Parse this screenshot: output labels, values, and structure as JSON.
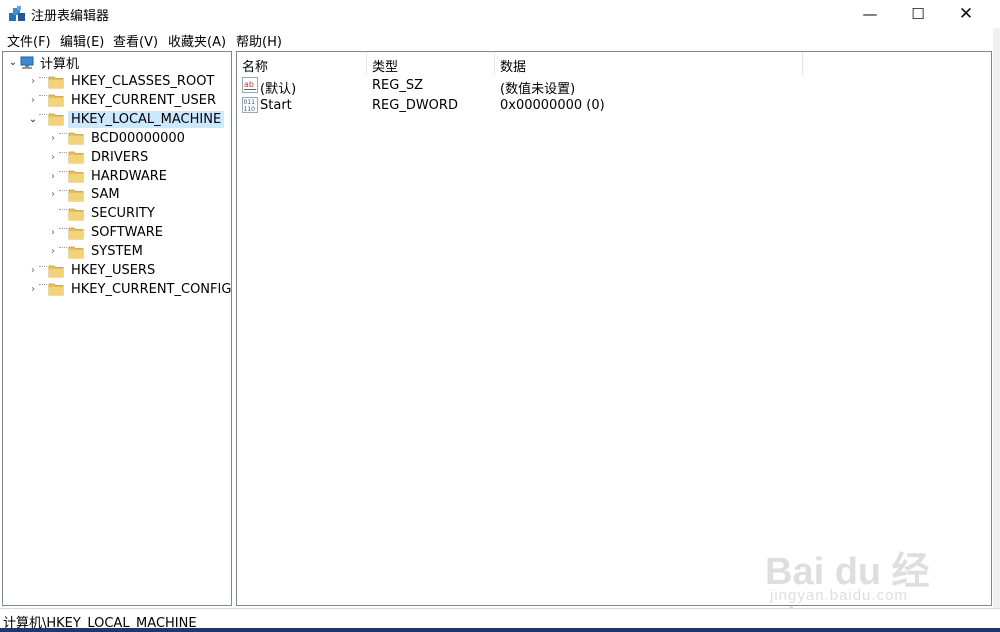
{
  "window": {
    "title": "注册表编辑器",
    "minimize": "—",
    "maximize": "☐",
    "close": "✕"
  },
  "menu": [
    {
      "label": "文件(F)"
    },
    {
      "label": "编辑(E)"
    },
    {
      "label": "查看(V)"
    },
    {
      "label": "收藏夹(A)"
    },
    {
      "label": "帮助(H)"
    }
  ],
  "tree": {
    "root": {
      "label": "计算机",
      "expanded": true
    },
    "items": [
      {
        "label": "HKEY_CLASSES_ROOT",
        "level": 1,
        "expander": "›"
      },
      {
        "label": "HKEY_CURRENT_USER",
        "level": 1,
        "expander": "›"
      },
      {
        "label": "HKEY_LOCAL_MACHINE",
        "level": 1,
        "expander": "⌄",
        "selected": true
      },
      {
        "label": "BCD00000000",
        "level": 2,
        "expander": "›"
      },
      {
        "label": "DRIVERS",
        "level": 2,
        "expander": "›"
      },
      {
        "label": "HARDWARE",
        "level": 2,
        "expander": "›"
      },
      {
        "label": "SAM",
        "level": 2,
        "expander": "›"
      },
      {
        "label": "SECURITY",
        "level": 2,
        "expander": ""
      },
      {
        "label": "SOFTWARE",
        "level": 2,
        "expander": "›"
      },
      {
        "label": "SYSTEM",
        "level": 2,
        "expander": "›"
      },
      {
        "label": "HKEY_USERS",
        "level": 1,
        "expander": "›"
      },
      {
        "label": "HKEY_CURRENT_CONFIG",
        "level": 1,
        "expander": "›"
      }
    ]
  },
  "list": {
    "columns": [
      "名称",
      "类型",
      "数据"
    ],
    "rows": [
      {
        "name": "(默认)",
        "type": "REG_SZ",
        "data": "(数值未设置)",
        "icon": "string-value-icon"
      },
      {
        "name": "Start",
        "type": "REG_DWORD",
        "data": "0x00000000 (0)",
        "icon": "binary-value-icon"
      }
    ]
  },
  "status": {
    "path": "计算机\\HKEY_LOCAL_MACHINE"
  },
  "watermark": {
    "main": "Bai du 经验",
    "sub": "jingyan.baidu.com"
  },
  "colors": {
    "selection": "#cce8ff",
    "folder": "#e8c05a",
    "border": "#828790"
  }
}
